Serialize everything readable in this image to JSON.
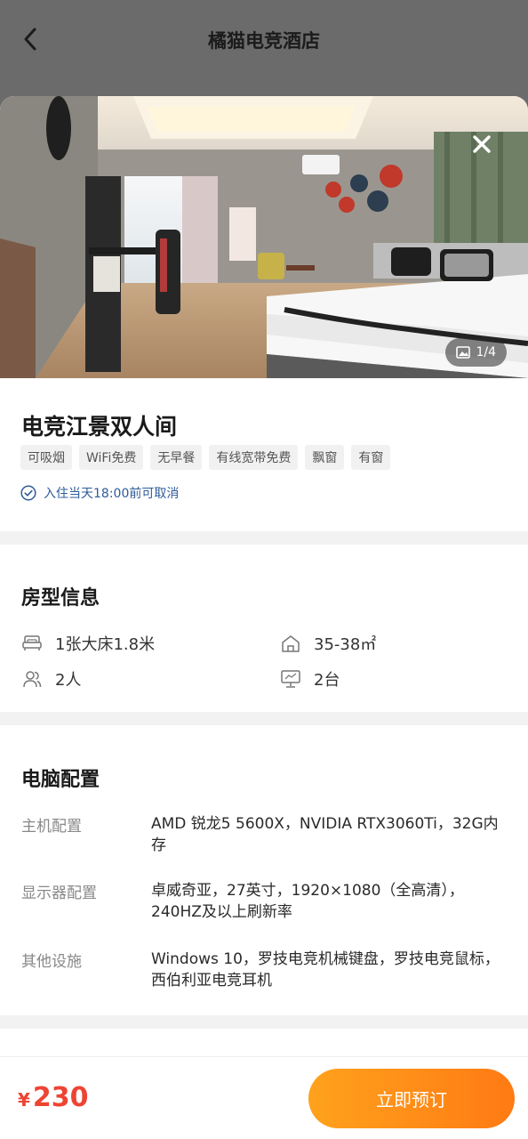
{
  "header": {
    "title": "橘猫电竞酒店"
  },
  "gallery": {
    "counter": "1/4"
  },
  "room": {
    "name": "电竞江景双人间",
    "tags": [
      "可吸烟",
      "WiFi免费",
      "无早餐",
      "有线宽带免费",
      "飘窗",
      "有窗"
    ],
    "cancel_policy": "入住当天18:00前可取消"
  },
  "room_info": {
    "title": "房型信息",
    "bed": "1张大床1.8米",
    "area": "35-38㎡",
    "guests": "2人",
    "computers": "2台"
  },
  "pc_config": {
    "title": "电脑配置",
    "rows": [
      {
        "label": "主机配置",
        "value": "AMD 锐龙5 5600X，NVIDIA RTX3060Ti，32G内存"
      },
      {
        "label": "显示器配置",
        "value": "卓威奇亚，27英寸，1920×1080（全高清），240HZ及以上刷新率"
      },
      {
        "label": "其他设施",
        "value": "Windows 10，罗技电竞机械键盘，罗技电竞鼠标，西伯利亚电竞耳机"
      }
    ]
  },
  "footer": {
    "currency": "¥",
    "price": "230",
    "book_label": "立即预订"
  },
  "colors": {
    "accent": "#ff8a18",
    "price": "#ee4433",
    "link": "#2e5b9a"
  }
}
